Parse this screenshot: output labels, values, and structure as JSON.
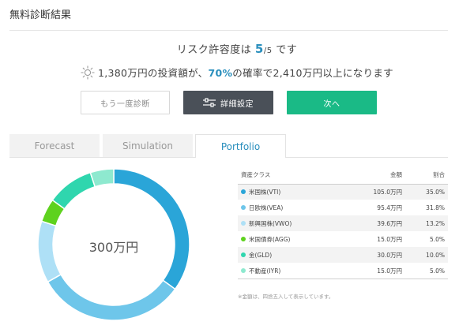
{
  "page": {
    "title": "無料診断結果"
  },
  "risk": {
    "prefix": "リスク許容度は",
    "value": "5",
    "denominator": "/5",
    "suffix": "です"
  },
  "summary": {
    "part1": "1,380万円の投資額が、",
    "probability": "70%",
    "part2": "の確率で2,410万円以上になります",
    "icon": "sun-icon"
  },
  "buttons": {
    "reset": "もう一度診断",
    "detail": "詳細設定",
    "detail_icon": "sliders-icon",
    "next": "次へ"
  },
  "tabs": [
    {
      "label": "Forecast",
      "active": false
    },
    {
      "label": "Simulation",
      "active": false
    },
    {
      "label": "Portfolio",
      "active": true
    }
  ],
  "chart_data": {
    "type": "pie",
    "center_label": "300万円",
    "categories": [
      "米国株(VTI)",
      "日欧株(VEA)",
      "新興国株(VWO)",
      "米国債券(AGG)",
      "金(GLD)",
      "不動産(IYR)"
    ],
    "values": [
      35.0,
      31.8,
      13.2,
      5.0,
      10.0,
      5.0
    ],
    "colors": [
      "#2aa5d8",
      "#6ec6ea",
      "#aee0f6",
      "#5ed21e",
      "#2fd6ae",
      "#8ee9cf"
    ]
  },
  "table": {
    "headers": {
      "name": "資産クラス",
      "amount": "金額",
      "ratio": "割合"
    },
    "rows": [
      {
        "name": "米国株(VTI)",
        "amount": "105.0万円",
        "ratio": "35.0%",
        "color": "#2aa5d8"
      },
      {
        "name": "日欧株(VEA)",
        "amount": "95.4万円",
        "ratio": "31.8%",
        "color": "#6ec6ea"
      },
      {
        "name": "新興国株(VWO)",
        "amount": "39.6万円",
        "ratio": "13.2%",
        "color": "#aee0f6"
      },
      {
        "name": "米国債券(AGG)",
        "amount": "15.0万円",
        "ratio": "5.0%",
        "color": "#5ed21e"
      },
      {
        "name": "金(GLD)",
        "amount": "30.0万円",
        "ratio": "10.0%",
        "color": "#2fd6ae"
      },
      {
        "name": "不動産(IYR)",
        "amount": "15.0万円",
        "ratio": "5.0%",
        "color": "#8ee9cf"
      }
    ],
    "note": "※金額は、四捨五入して表示しています。"
  },
  "colors": {
    "accent": "#2a8fbd",
    "next_button": "#1aba86",
    "detail_button": "#4a5058"
  }
}
